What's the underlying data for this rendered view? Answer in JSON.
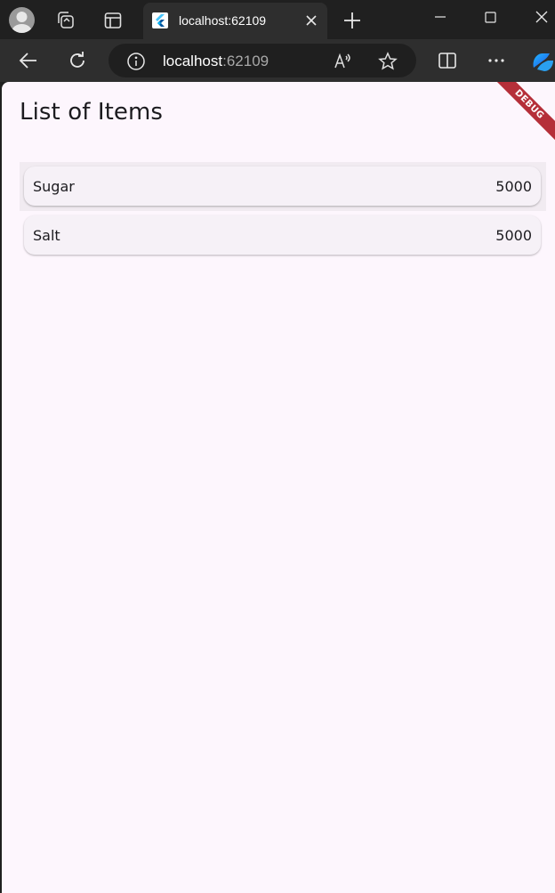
{
  "browser": {
    "tab": {
      "title": "localhost:62109"
    },
    "address": {
      "host": "localhost",
      "port": ":62109"
    },
    "icons": {
      "avatar": "profile-avatar-icon",
      "workspaces": "workspaces-icon",
      "tab_actions": "tab-actions-icon",
      "favicon": "flutter-favicon",
      "close_tab": "close-icon",
      "new_tab": "plus-icon",
      "back": "back-arrow-icon",
      "reload": "reload-icon",
      "info": "info-icon",
      "read_aloud": "read-aloud-icon",
      "favorite": "star-icon",
      "split": "split-screen-icon",
      "more": "more-icon",
      "copilot": "copilot-icon"
    }
  },
  "app": {
    "title": "List of Items",
    "debug_banner": "DEBUG",
    "items": [
      {
        "name": "Sugar",
        "quantity": "5000"
      },
      {
        "name": "Salt",
        "quantity": "5000"
      }
    ]
  },
  "colors": {
    "page_background": "#fdf6fd",
    "card_background": "#f6f1f7",
    "debug_banner": "#b52f39",
    "browser_chrome": "#202020"
  }
}
